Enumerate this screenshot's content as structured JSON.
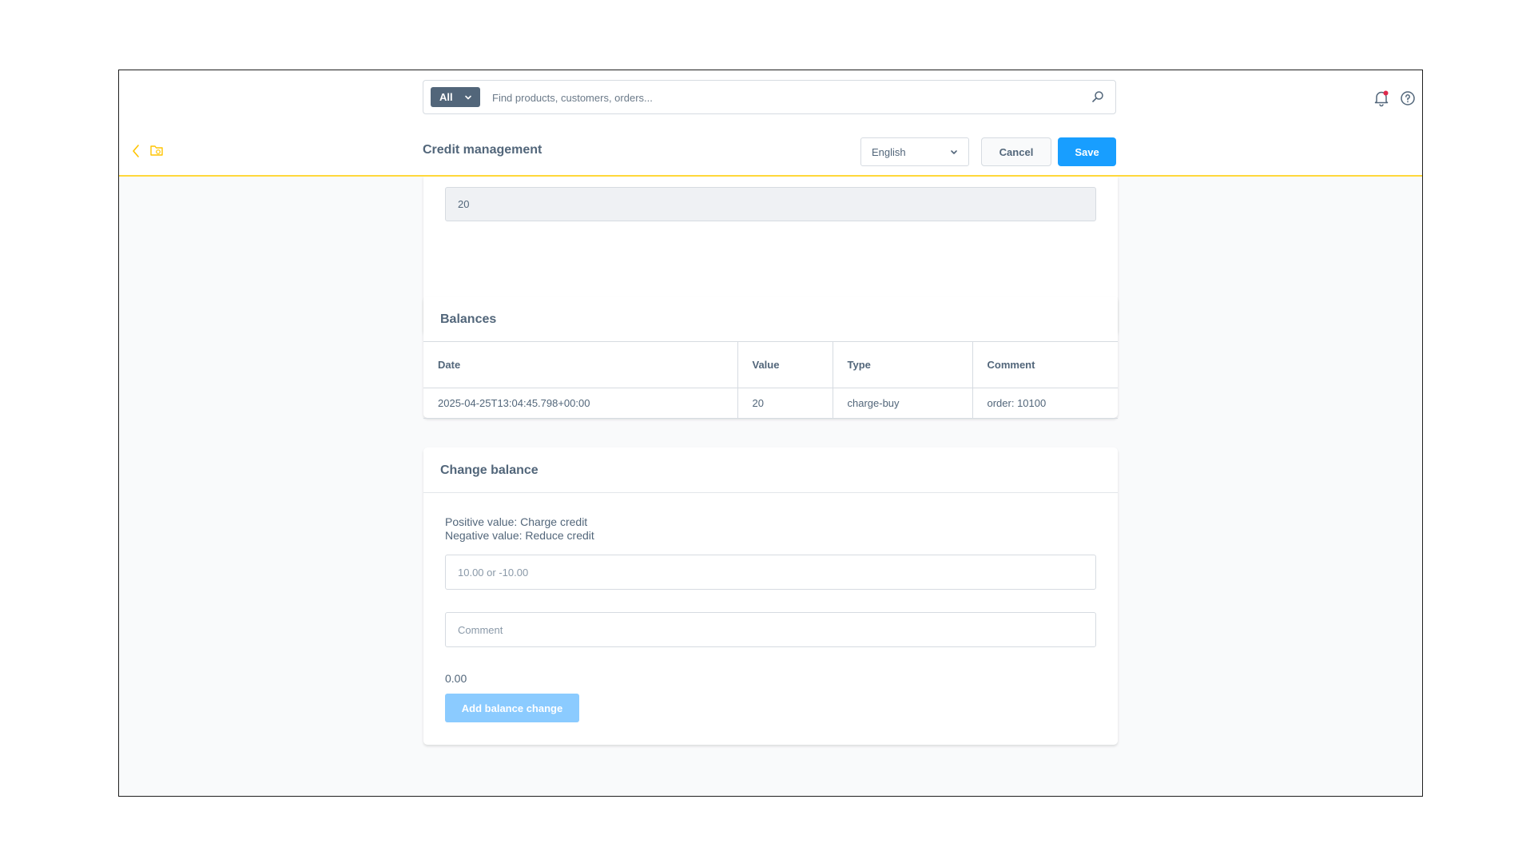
{
  "header": {
    "search_type": "All",
    "search_placeholder": "Find products, customers, orders..."
  },
  "smartbar": {
    "title": "Credit management",
    "language": "English",
    "cancel_label": "Cancel",
    "save_label": "Save"
  },
  "top_card": {
    "field_value": "20"
  },
  "balances": {
    "title": "Balances",
    "columns": [
      "Date",
      "Value",
      "Type",
      "Comment"
    ],
    "rows": [
      [
        "2025-04-25T13:04:45.798+00:00",
        "20",
        "charge-buy",
        "order: 10100"
      ]
    ]
  },
  "change_balance": {
    "title": "Change balance",
    "hint_positive": "Positive value: Charge credit",
    "hint_negative": "Negative value: Reduce credit",
    "value_placeholder": "10.00 or -10.00",
    "comment_placeholder": "Comment",
    "total": "0.00",
    "add_label": "Add balance change"
  },
  "colors": {
    "primary": "#189eff",
    "primary_disabled": "#8bcbff",
    "accent_border": "#ffd83b",
    "text": "#52667a"
  },
  "icons": [
    "chevron-down-icon",
    "search-icon",
    "bell-icon",
    "help-icon",
    "back-icon",
    "folder-icon"
  ]
}
